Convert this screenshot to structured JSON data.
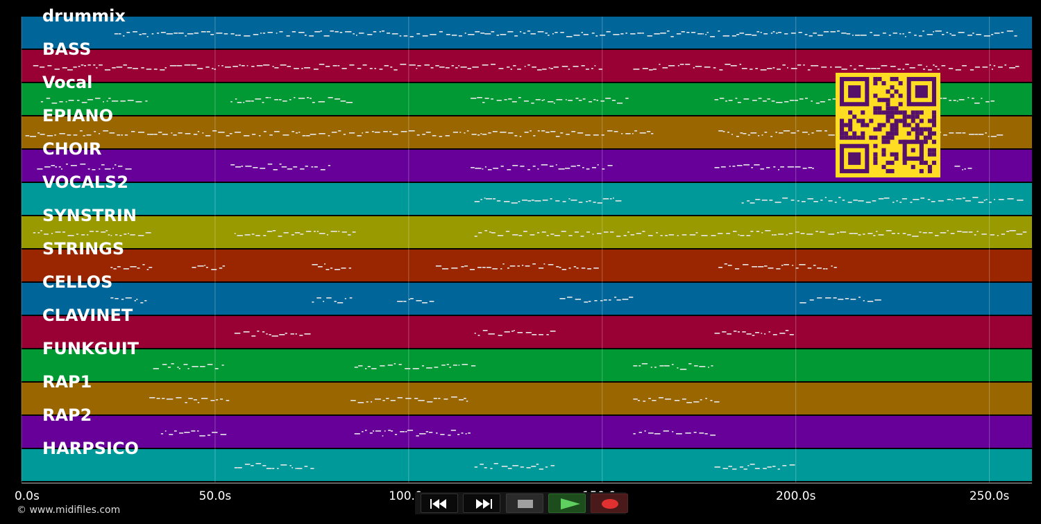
{
  "tracks": [
    {
      "name": "drummix",
      "color": "#006699"
    },
    {
      "name": "BASS",
      "color": "#990033"
    },
    {
      "name": "Vocal",
      "color": "#009933"
    },
    {
      "name": "EPIANO",
      "color": "#996600"
    },
    {
      "name": "CHOIR",
      "color": "#660099"
    },
    {
      "name": "VOCALS2",
      "color": "#009999"
    },
    {
      "name": "SYNSTRIN",
      "color": "#999900"
    },
    {
      "name": "STRINGS",
      "color": "#992600"
    },
    {
      "name": "CELLOS",
      "color": "#006699"
    },
    {
      "name": "CLAVINET",
      "color": "#990033"
    },
    {
      "name": "FUNKGUIT",
      "color": "#009933"
    },
    {
      "name": "RAP1",
      "color": "#996600"
    },
    {
      "name": "RAP2",
      "color": "#660099"
    },
    {
      "name": "HARPSICO",
      "color": "#009999"
    }
  ],
  "timeline": {
    "max_seconds": 261,
    "ticks": [
      "0.0s",
      "50.0s",
      "100.0s",
      "150.0s",
      "200.0s",
      "250.0s"
    ],
    "tick_values": [
      0,
      50,
      100,
      150,
      200,
      250
    ]
  },
  "footer": {
    "copyright": "© www.midifiles.com"
  },
  "transport": {
    "buttons": [
      {
        "name": "rewind-button",
        "icon": "rewind-icon",
        "color": "#ffffff"
      },
      {
        "name": "fast-forward-button",
        "icon": "fast-forward-icon",
        "color": "#ffffff"
      },
      {
        "name": "stop-button",
        "icon": "stop-icon",
        "color": "#a0a0a0"
      },
      {
        "name": "play-button",
        "icon": "play-icon",
        "color": "#5fcf5f"
      },
      {
        "name": "record-button",
        "icon": "record-icon",
        "color": "#e03030"
      }
    ]
  },
  "overlay": {
    "qr_color_bg": "#ffdd22",
    "qr_color_fg": "#55116a"
  }
}
